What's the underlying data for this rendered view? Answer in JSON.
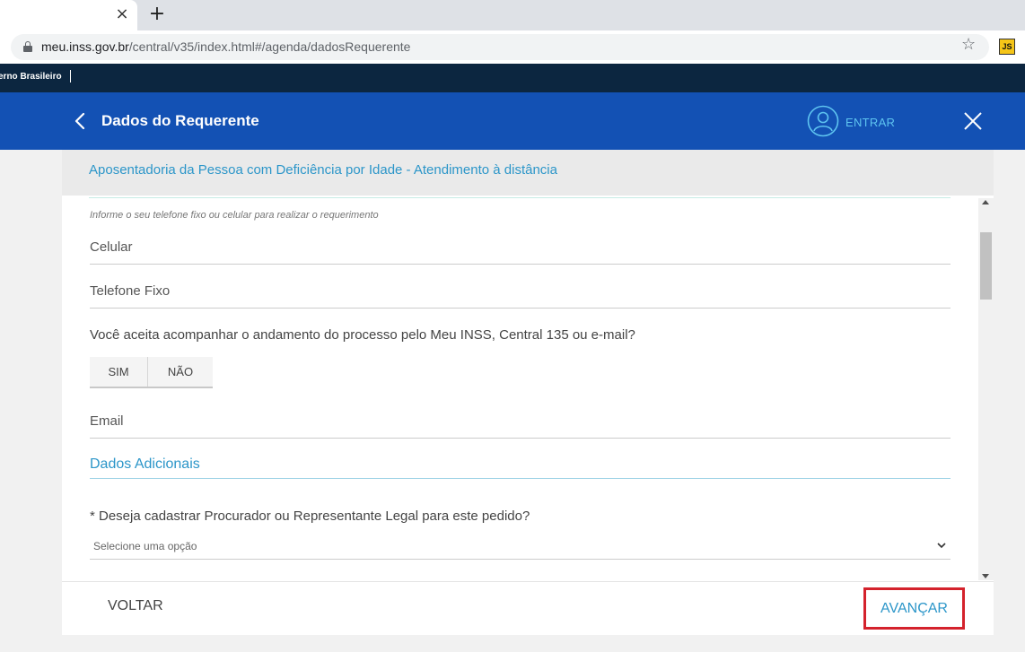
{
  "browser": {
    "tab_close": "×",
    "new_tab": "+",
    "url_host": "meu.inss.gov.br",
    "url_path": "/central/v35/index.html#/agenda/dadosRequerente",
    "bookmark_star": "☆",
    "extension_label": "JS"
  },
  "govbar": {
    "text": "erno Brasileiro"
  },
  "header": {
    "title": "Dados do Requerente",
    "login_label": "ENTRAR"
  },
  "content": {
    "subtitle": "Aposentadoria da Pessoa com Deficiência por Idade - Atendimento à distância",
    "phone_hint": "Informe o seu telefone fixo ou celular para realizar o requerimento",
    "fields": {
      "celular": "Celular",
      "telefone_fixo": "Telefone Fixo",
      "email": "Email"
    },
    "accept_question": "Você aceita acompanhar o andamento do processo pelo Meu INSS, Central 135 ou e-mail?",
    "accept_options": {
      "yes": "SIM",
      "no": "NÃO"
    },
    "section_title": "Dados Adicionais",
    "procurador_question": "* Deseja cadastrar Procurador ou Representante Legal para este pedido?",
    "procurador_select_value": "Selecione uma opção"
  },
  "footer": {
    "back_label": "VOLTAR",
    "next_label": "AVANÇAR"
  },
  "colors": {
    "header_blue": "#1351b4",
    "accent_cyan": "#2c96c9",
    "highlight_red": "#d4222c",
    "govbar_navy": "#0c2640"
  }
}
